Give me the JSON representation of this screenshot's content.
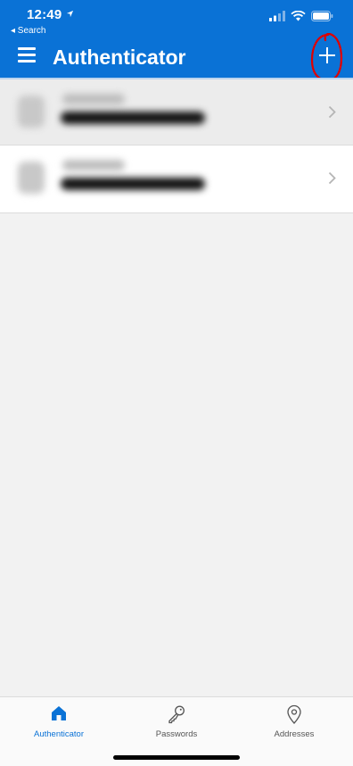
{
  "status_bar": {
    "time": "12:49",
    "back_label": "◂ Search"
  },
  "header": {
    "title": "Authenticator"
  },
  "accounts": [
    {
      "style": "gray"
    },
    {
      "style": "white"
    }
  ],
  "tabs": [
    {
      "label": "Authenticator",
      "icon": "home-icon",
      "active": true
    },
    {
      "label": "Passwords",
      "icon": "key-icon",
      "active": false
    },
    {
      "label": "Addresses",
      "icon": "location-pin-icon",
      "active": false
    }
  ],
  "colors": {
    "brand": "#0a72d6",
    "annotation": "#e00000"
  }
}
